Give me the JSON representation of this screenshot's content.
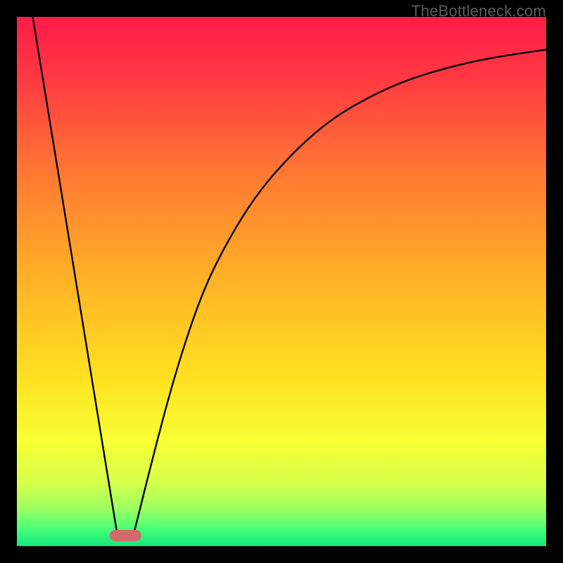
{
  "watermark": "TheBottleneck.com",
  "chart_data": {
    "type": "line",
    "title": "",
    "xlabel": "",
    "ylabel": "",
    "xlim": [
      0,
      100
    ],
    "ylim": [
      0,
      100
    ],
    "grid": false,
    "legend": false,
    "series": [
      {
        "name": "left-descent",
        "x": [
          3,
          19
        ],
        "values": [
          100,
          2
        ]
      },
      {
        "name": "right-curve",
        "x": [
          22,
          26,
          30,
          35,
          40,
          45,
          50,
          55,
          60,
          65,
          70,
          75,
          80,
          85,
          90,
          95,
          100
        ],
        "values": [
          2,
          18,
          33,
          48,
          58,
          66,
          72,
          77,
          81,
          84,
          86.5,
          88.5,
          90,
          91.3,
          92.3,
          93.1,
          93.8
        ]
      }
    ],
    "marker": {
      "name": "bottom-pill",
      "x_center": 20.5,
      "y_center": 2,
      "width": 6,
      "color": "#d36a6a"
    },
    "gradient_stops": [
      {
        "offset": 0.0,
        "color": "#ff1c48"
      },
      {
        "offset": 0.12,
        "color": "#ff3a42"
      },
      {
        "offset": 0.3,
        "color": "#ff7a32"
      },
      {
        "offset": 0.5,
        "color": "#ffb326"
      },
      {
        "offset": 0.68,
        "color": "#ffe021"
      },
      {
        "offset": 0.8,
        "color": "#f7ff33"
      },
      {
        "offset": 0.88,
        "color": "#d6ff4a"
      },
      {
        "offset": 0.93,
        "color": "#9cff62"
      },
      {
        "offset": 0.965,
        "color": "#4dff78"
      },
      {
        "offset": 1.0,
        "color": "#12e87c"
      }
    ]
  }
}
